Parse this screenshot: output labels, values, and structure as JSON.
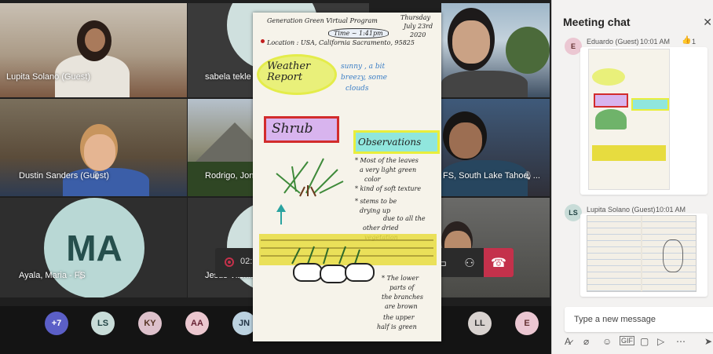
{
  "participants": {
    "lupita": {
      "name": "Lupita Solano (Guest)"
    },
    "sabela": {
      "name": "sabela tekle (Gu"
    },
    "dustin": {
      "name": "Dustin Sanders (Guest)"
    },
    "rodrigo": {
      "name": "Rodrigo, Jonar J"
    },
    "fs": {
      "name": "FS, South Lake Tahoe, ..."
    },
    "ayala": {
      "name": "Ayala, Maria - FS",
      "initials": "MA"
    },
    "jesus": {
      "name": "Jesus Vilchis"
    }
  },
  "controls": {
    "timer": "02:"
  },
  "bubbles": {
    "overflow": "+7",
    "items": [
      "LS",
      "KY",
      "AA",
      "JN",
      "LL",
      "E"
    ]
  },
  "drawing": {
    "title_line1": "Generation Green Virtual Program",
    "date_line1": "Thursday",
    "date_line2": "July 23rd",
    "date_line3": "2020",
    "time": "Time ~ 1:41pm",
    "location": "Location : USA, California Sacramento, 95825",
    "weather_label": "Weather Report",
    "weather_text1": "sunny , a bit",
    "weather_text2": "breezy, some",
    "weather_text3": "clouds",
    "shrub_label": "Shrub",
    "observations_label": "Observations",
    "obs1a": "* Most of the leaves",
    "obs1b": "a very light green",
    "obs1c": "color",
    "obs2": "* kind of soft texture",
    "obs3a": "* stems to be",
    "obs3b": "drying up",
    "obs3c": "due to all the",
    "obs3d": "other dried",
    "obs3e": "vegetation",
    "obs4a": "* The lower",
    "obs4b": "parts of",
    "obs4c": "the branches",
    "obs4d": "are brown",
    "obs4e": "the upper",
    "obs4f": "half is green"
  },
  "chat": {
    "title": "Meeting chat",
    "messages": [
      {
        "initials": "E",
        "sender": "Eduardo (Guest)",
        "time": "10:01 AM",
        "reaction": "1"
      },
      {
        "initials": "LS",
        "sender": "Lupita Solano (Guest)",
        "time": "10:01 AM"
      }
    ],
    "compose_placeholder": "Type a new message"
  }
}
